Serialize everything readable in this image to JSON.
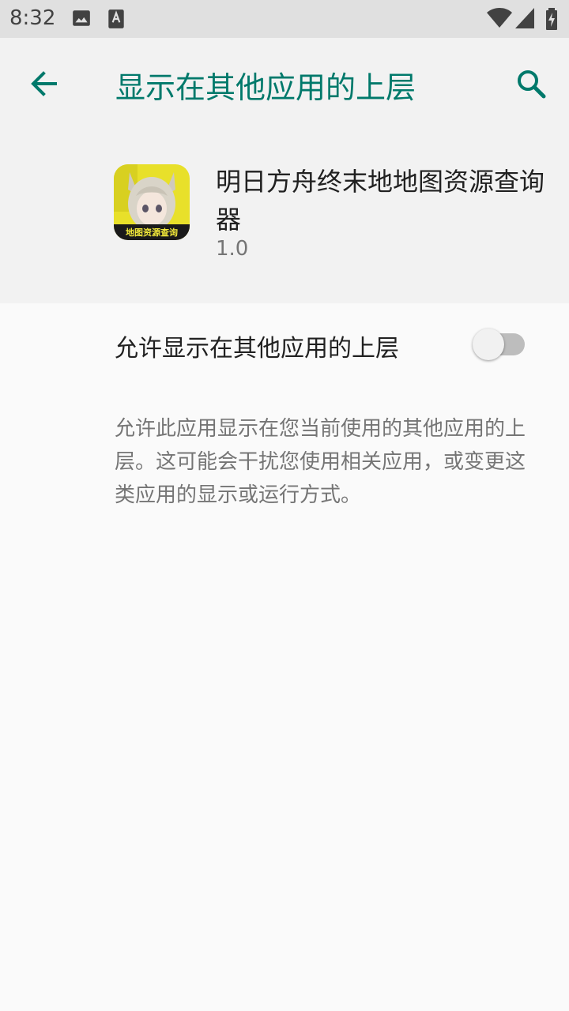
{
  "status_bar": {
    "time": "8:32",
    "icons": [
      "image-icon",
      "accessibility-a-icon",
      "wifi-icon",
      "signal-icon",
      "battery-charging-icon"
    ]
  },
  "app_bar": {
    "title": "显示在其他应用的上层",
    "back_icon": "arrow-back-icon",
    "search_icon": "search-icon",
    "accent_color": "#00796b"
  },
  "app_info": {
    "name": "明日方舟终末地地图资源查询器",
    "version": "1.0",
    "icon_badge_text": "地图资源查询"
  },
  "preference": {
    "label": "允许显示在其他应用的上层",
    "switch_on": false
  },
  "description": "允许此应用显示在您当前使用的其他应用的上层。这可能会干扰您使用相关应用，或变更这类应用的显示或运行方式。"
}
